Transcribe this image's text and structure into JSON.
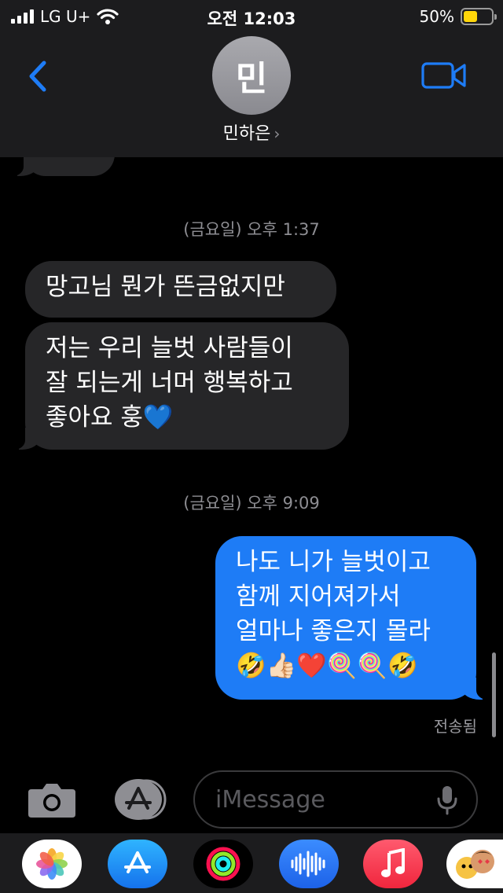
{
  "status_bar": {
    "carrier": "LG U+",
    "time": "오전 12:03",
    "battery": "50%",
    "battery_fraction": 0.5
  },
  "header": {
    "avatar_initial": "민",
    "contact_name": "민하은"
  },
  "messages": [
    {
      "timestamp": "(금요일) 오후 1:37"
    },
    {
      "incoming_1": [
        "망고님 뭔가 뜬금없지만"
      ]
    },
    {
      "incoming_2": [
        "저는 우리 늘벗 사람들이",
        "잘 되는게 너머 행복하고",
        "좋아요 훙💙"
      ]
    },
    {
      "timestamp": "(금요일) 오후 9:09"
    },
    {
      "outgoing_1": [
        "나도 니가 늘벗이고",
        "함께 지어져가서",
        "얼마나 좋은지 몰라",
        "🤣👍🏻❤️🍭🍭🤣"
      ]
    }
  ],
  "delivery_status": "전송됨",
  "composer": {
    "placeholder": "iMessage"
  },
  "app_drawer": [
    "photos-app",
    "app-store-app",
    "fitness-app",
    "audio-message-app",
    "music-app",
    "memoji-stickers-app"
  ],
  "colors": {
    "outgoing_bubble": "#1e7cf6",
    "incoming_bubble": "#262628",
    "accent": "#1e7cf6",
    "battery": "#ffd60a"
  }
}
